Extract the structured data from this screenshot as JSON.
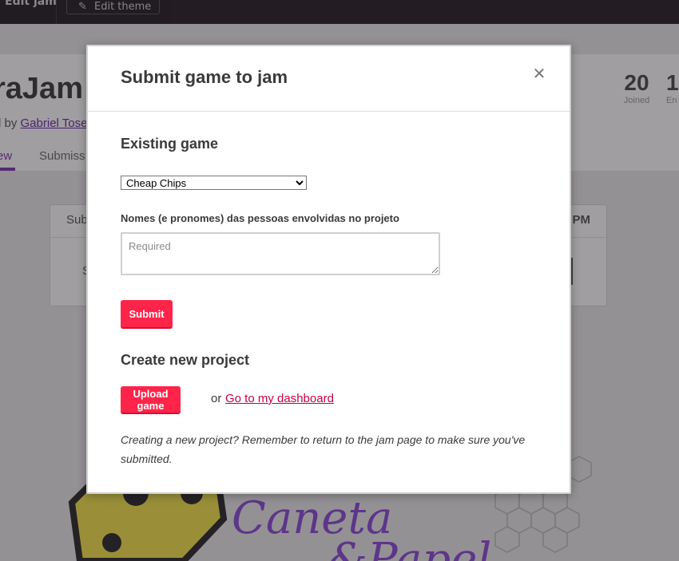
{
  "topbar": {
    "edit_jam": "Edit jam",
    "edit_theme": "Edit theme"
  },
  "jam": {
    "title_partial": "raJam",
    "hosted_prefix": "l by",
    "host_name": "Gabriel Tose",
    "tab_overview": "ew",
    "tab_submissions": "Submiss",
    "stats": [
      {
        "value": "20",
        "label": "Joined"
      },
      {
        "value": "1",
        "label": "En"
      }
    ]
  },
  "countdown": {
    "header_left": "Sub",
    "header_right": "PM",
    "row_text": "S"
  },
  "banner": {
    "text_line1": "Caneta",
    "text_line2": "&Papel"
  },
  "modal": {
    "title": "Submit game to jam",
    "existing_heading": "Existing game",
    "selected_game": "Cheap Chips",
    "names_label": "Nomes (e pronomes) das pessoas envolvidas no projeto",
    "names_placeholder": "Required",
    "submit_label": "Submit",
    "create_heading": "Create new project",
    "upload_label": "Upload game",
    "or_text": "or",
    "dashboard_link": "Go to my dashboard",
    "note": "Creating a new project? Remember to return to the jam page to make sure you've submitted."
  },
  "colors": {
    "accent": "#ff2449",
    "link": "#c8004a",
    "brand_purple": "#7a3aaa"
  }
}
